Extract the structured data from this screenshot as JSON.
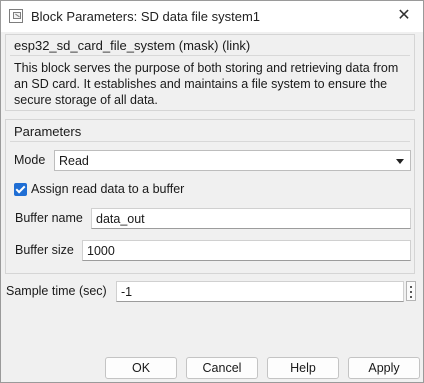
{
  "window": {
    "title": "Block Parameters: SD data file system1"
  },
  "description": {
    "mask_title": "esp32_sd_card_file_system (mask) (link)",
    "text": "This block serves the purpose of both storing and retrieving data from an SD card. It establishes and maintains a file system to ensure the secure storage of all data."
  },
  "parameters": {
    "group_title": "Parameters",
    "mode_label": "Mode",
    "mode_value": "Read",
    "assign_label": "Assign read data to a buffer",
    "assign_checked": true,
    "buffer_name_label": "Buffer name",
    "buffer_name_value": "data_out",
    "buffer_size_label": "Buffer size",
    "buffer_size_value": "1000"
  },
  "sample_time": {
    "label": "Sample time (sec)",
    "value": "-1"
  },
  "buttons": {
    "ok": "OK",
    "cancel": "Cancel",
    "help": "Help",
    "apply": "Apply"
  },
  "colors": {
    "checkbox": "#1f6ed4"
  }
}
